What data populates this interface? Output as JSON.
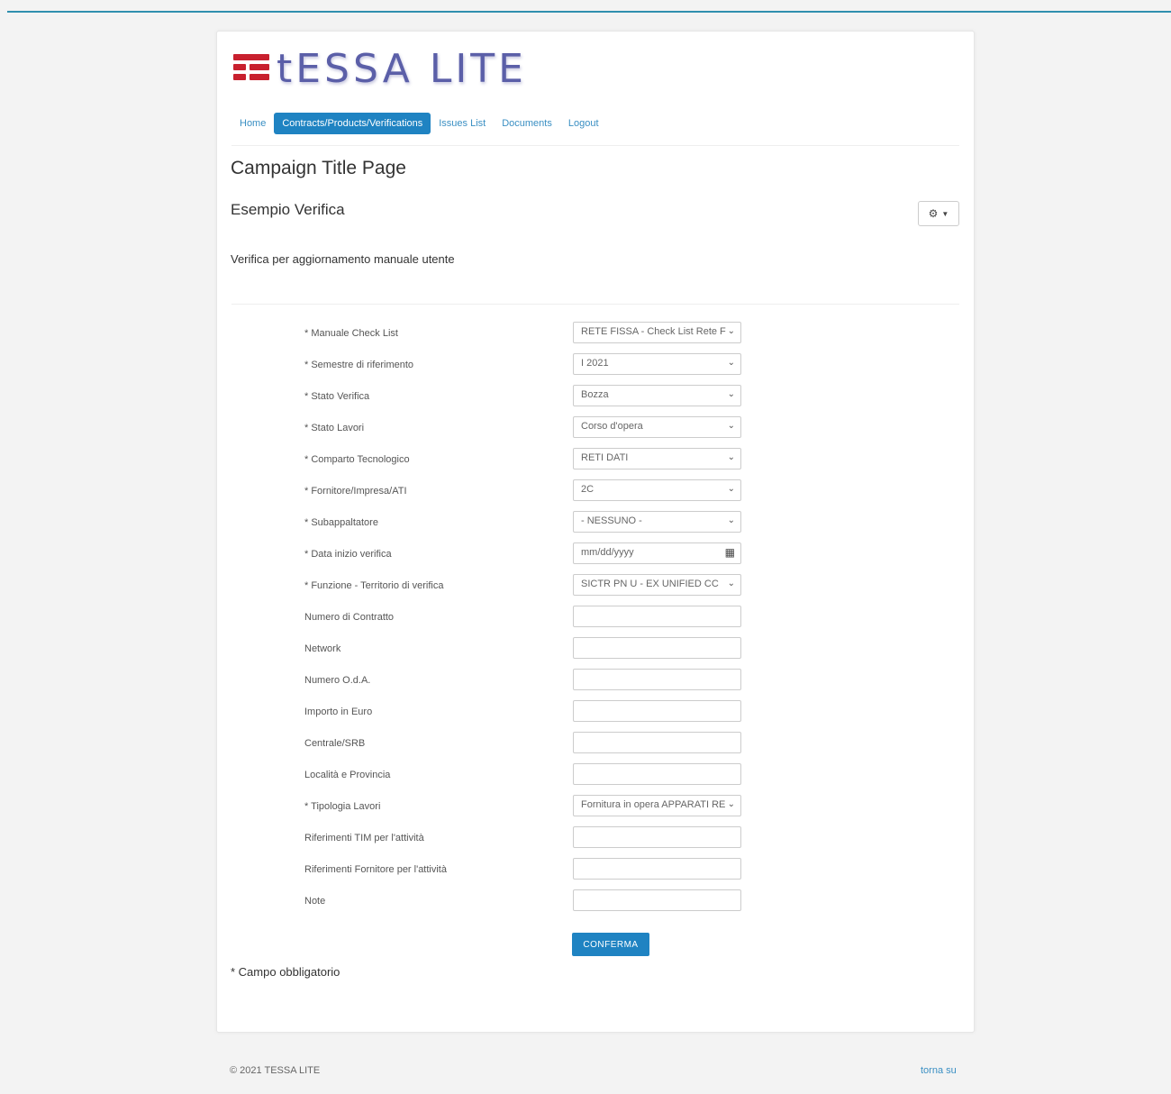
{
  "brand": {
    "logo_text": "tESSA LITE",
    "accent_color": "#1f83c2",
    "logo_color": "#c8202e"
  },
  "nav": {
    "items": [
      {
        "label": "Home",
        "active": false
      },
      {
        "label": "Contracts/Products/Verifications",
        "active": true
      },
      {
        "label": "Issues List",
        "active": false
      },
      {
        "label": "Documents",
        "active": false
      },
      {
        "label": "Logout",
        "active": false
      }
    ]
  },
  "page": {
    "title": "Campaign Title Page",
    "subtitle": "Esempio Verifica",
    "description": "Verifica per aggiornamento manuale utente",
    "settings_icon": "gear-icon"
  },
  "form": {
    "fields": [
      {
        "label": "* Manuale Check List",
        "type": "select",
        "value": "RETE FISSA - Check List Rete F"
      },
      {
        "label": "* Semestre di riferimento",
        "type": "select",
        "value": "I 2021"
      },
      {
        "label": "* Stato Verifica",
        "type": "select",
        "value": "Bozza"
      },
      {
        "label": "* Stato Lavori",
        "type": "select",
        "value": "Corso d'opera"
      },
      {
        "label": "* Comparto Tecnologico",
        "type": "select",
        "value": "RETI DATI"
      },
      {
        "label": "* Fornitore/Impresa/ATI",
        "type": "select",
        "value": "2C"
      },
      {
        "label": "* Subappaltatore",
        "type": "select",
        "value": "- NESSUNO -"
      },
      {
        "label": "* Data inizio verifica",
        "type": "date",
        "value": "mm/dd/yyyy"
      },
      {
        "label": "* Funzione - Territorio di verifica",
        "type": "select",
        "value": "SICTR PN U - EX UNIFIED CC"
      },
      {
        "label": "Numero di Contratto",
        "type": "text",
        "value": ""
      },
      {
        "label": "Network",
        "type": "text",
        "value": ""
      },
      {
        "label": "Numero O.d.A.",
        "type": "text",
        "value": ""
      },
      {
        "label": "Importo in Euro",
        "type": "text",
        "value": ""
      },
      {
        "label": "Centrale/SRB",
        "type": "text",
        "value": ""
      },
      {
        "label": "Località e Provincia",
        "type": "text",
        "value": ""
      },
      {
        "label": "* Tipologia Lavori",
        "type": "select",
        "value": "Fornitura in opera APPARATI RE"
      },
      {
        "label": "Riferimenti TIM per l'attività",
        "type": "text",
        "value": ""
      },
      {
        "label": "Riferimenti Fornitore per l'attività",
        "type": "text",
        "value": ""
      },
      {
        "label": "Note",
        "type": "text",
        "value": ""
      }
    ],
    "submit_label": "CONFERMA",
    "required_note": "* Campo obbligatorio"
  },
  "footer": {
    "copyright": "© 2021 TESSA LITE",
    "back_to_top": "torna su"
  }
}
